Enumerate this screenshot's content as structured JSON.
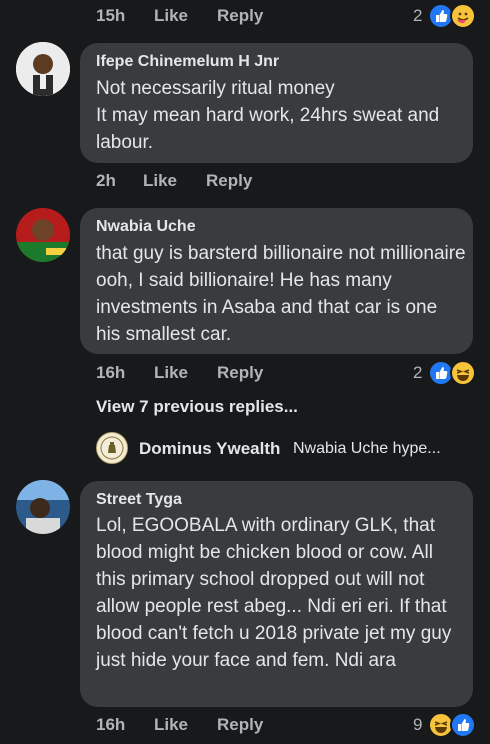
{
  "comments": [
    {
      "time": "15h",
      "like_label": "Like",
      "reply_label": "Reply",
      "reaction_count": "2"
    },
    {
      "author": "Ifepe Chinemelum H Jnr",
      "text": "Not necessarily ritual money\nIt may mean hard work, 24hrs sweat and labour.",
      "time": "2h",
      "like_label": "Like",
      "reply_label": "Reply"
    },
    {
      "author": "Nwabia Uche",
      "text": "that guy is barsterd billionaire not millionaire ooh, I said billionaire! He has many investments in Asaba and that car is one his smallest car.",
      "time": "16h",
      "like_label": "Like",
      "reply_label": "Reply",
      "reaction_count": "2",
      "view_replies": "View 7 previous replies...",
      "reply_preview": {
        "author": "Dominus Ywealth",
        "text": "Nwabia Uche hype..."
      }
    },
    {
      "author": "Street Tyga",
      "text": "Lol, EGOOBALA with ordinary GLK, that blood might be chicken blood or cow. All this primary school dropped out will not allow people rest abeg... Ndi eri eri. If that blood can't fetch u 2018 private jet my guy just hide your face and fem. Ndi ara",
      "time": "16h",
      "like_label": "Like",
      "reply_label": "Reply",
      "reaction_count": "9"
    }
  ],
  "colors": {
    "background": "#18191a",
    "bubble": "#3a3b3c",
    "text": "#e4e6eb",
    "secondary_text": "#b0b3b8",
    "like_blue": "#2078f4",
    "haha_yellow": "#f7c33c"
  },
  "icons": [
    "like-reaction-icon",
    "care-reaction-icon",
    "haha-reaction-icon"
  ]
}
